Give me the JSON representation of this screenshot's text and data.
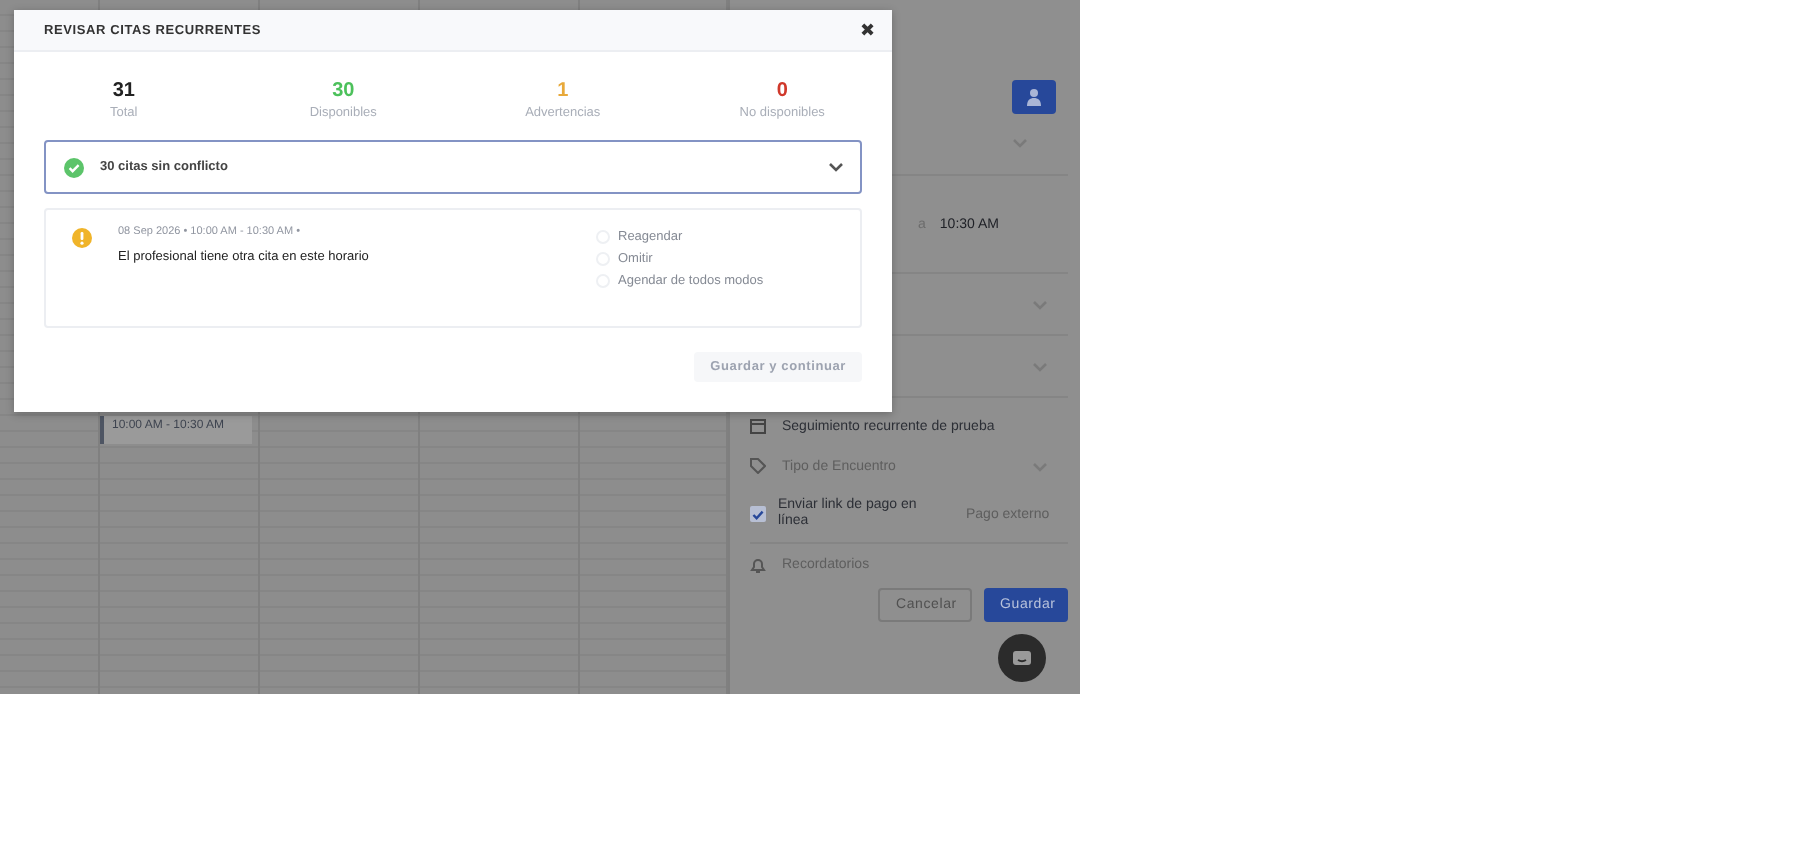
{
  "calendar": {
    "event": {
      "time": "10:00 AM - 10:30 AM"
    }
  },
  "side_panel": {
    "time_end": {
      "separator": "a",
      "value": "10:30 AM"
    },
    "recurrence": "Seguimiento recurrente de prueba",
    "encounter_type": {
      "placeholder": "Tipo de Encuentro"
    },
    "payment_link": {
      "label": "Enviar link de pago en línea",
      "checked": true,
      "value": "Pago externo"
    },
    "reminders": "Recordatorios",
    "buttons": [
      "Cancelar",
      "Guardar"
    ]
  },
  "modal": {
    "title": "REVISAR CITAS RECURRENTES",
    "close": "✖",
    "stats": [
      {
        "value": "31",
        "label": "Total",
        "color": "#222222"
      },
      {
        "value": "30",
        "label": "Disponibles",
        "color": "#4cc15b"
      },
      {
        "value": "1",
        "label": "Advertencias",
        "color": "#e8a93a"
      },
      {
        "value": "0",
        "label": "No disponibles",
        "color": "#d0392b"
      }
    ],
    "no_conflict": {
      "label": "30 citas sin conflicto"
    },
    "conflicts": [
      {
        "date": "08 Sep 2026  •  10:00 AM - 10:30 AM  •",
        "message": "El profesional tiene otra cita en este horario",
        "options": [
          {
            "label": "Reagendar",
            "selected": false
          },
          {
            "label": "Omitir",
            "selected": false
          },
          {
            "label": "Agendar de todos modos",
            "selected": false
          }
        ]
      }
    ],
    "save": {
      "label": "Guardar y continuar",
      "disabled": true
    }
  }
}
